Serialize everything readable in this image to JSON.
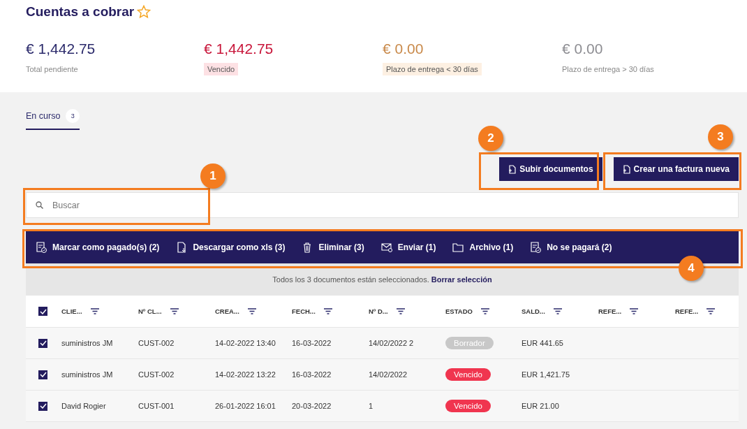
{
  "page": {
    "title": "Cuentas a cobrar",
    "favorite": false
  },
  "stats": [
    {
      "amount": "€ 1,442.75",
      "label": "Total pendiente",
      "kind": "total"
    },
    {
      "amount": "€ 1,442.75",
      "label": "Vencido",
      "kind": "overdue"
    },
    {
      "amount": "€ 0.00",
      "label": "Plazo de entrega < 30 días",
      "kind": "due_soon"
    },
    {
      "amount": "€ 0.00",
      "label": "Plazo de entrega > 30 días",
      "kind": "due_later"
    }
  ],
  "tabs": [
    {
      "label": "En curso",
      "count": "3",
      "selected": true
    }
  ],
  "buttons": [
    "Subir documentos",
    "Crear una factura nueva"
  ],
  "search": {
    "placeholder": "Buscar"
  },
  "actions": [
    "Marcar como pagado(s) (2)",
    "Descargar como xls (3)",
    "Eliminar (3)",
    "Enviar (1)",
    "Archivo (1)",
    "No se pagará (2)"
  ],
  "selection_notice": {
    "text": "Todos los 3 documentos están seleccionados.",
    "link": "Borrar selección"
  },
  "table": {
    "all_checked": true,
    "columns": [
      "CLIE...",
      "Nº CL...",
      "CREA...",
      "FECH...",
      "Nº D...",
      "ESTADO",
      "SALD...",
      "REFE...",
      "REFE..."
    ],
    "rows": [
      {
        "checked": true,
        "cells": [
          "suministros JM",
          "CUST-002",
          "14-02-2022 13:40",
          "16-03-2022",
          "14/02/2022 2"
        ],
        "status": {
          "label": "Borrador",
          "kind": "draft"
        },
        "balance": "EUR 441.65"
      },
      {
        "checked": true,
        "cells": [
          "suministros JM",
          "CUST-002",
          "14-02-2022 13:22",
          "16-03-2022",
          "14/02/2022"
        ],
        "status": {
          "label": "Vencido",
          "kind": "overdue"
        },
        "balance": "EUR 1,421.75"
      },
      {
        "checked": true,
        "cells": [
          "David Rogier",
          "CUST-001",
          "26-01-2022 16:01",
          "20-03-2022",
          "1"
        ],
        "status": {
          "label": "Vencido",
          "kind": "overdue"
        },
        "balance": "EUR 21.00"
      }
    ]
  },
  "annotations": [
    {
      "label": "1",
      "kind": "search"
    },
    {
      "label": "2",
      "kind": "upload"
    },
    {
      "label": "3",
      "kind": "create"
    },
    {
      "label": "4",
      "kind": "actions"
    }
  ]
}
